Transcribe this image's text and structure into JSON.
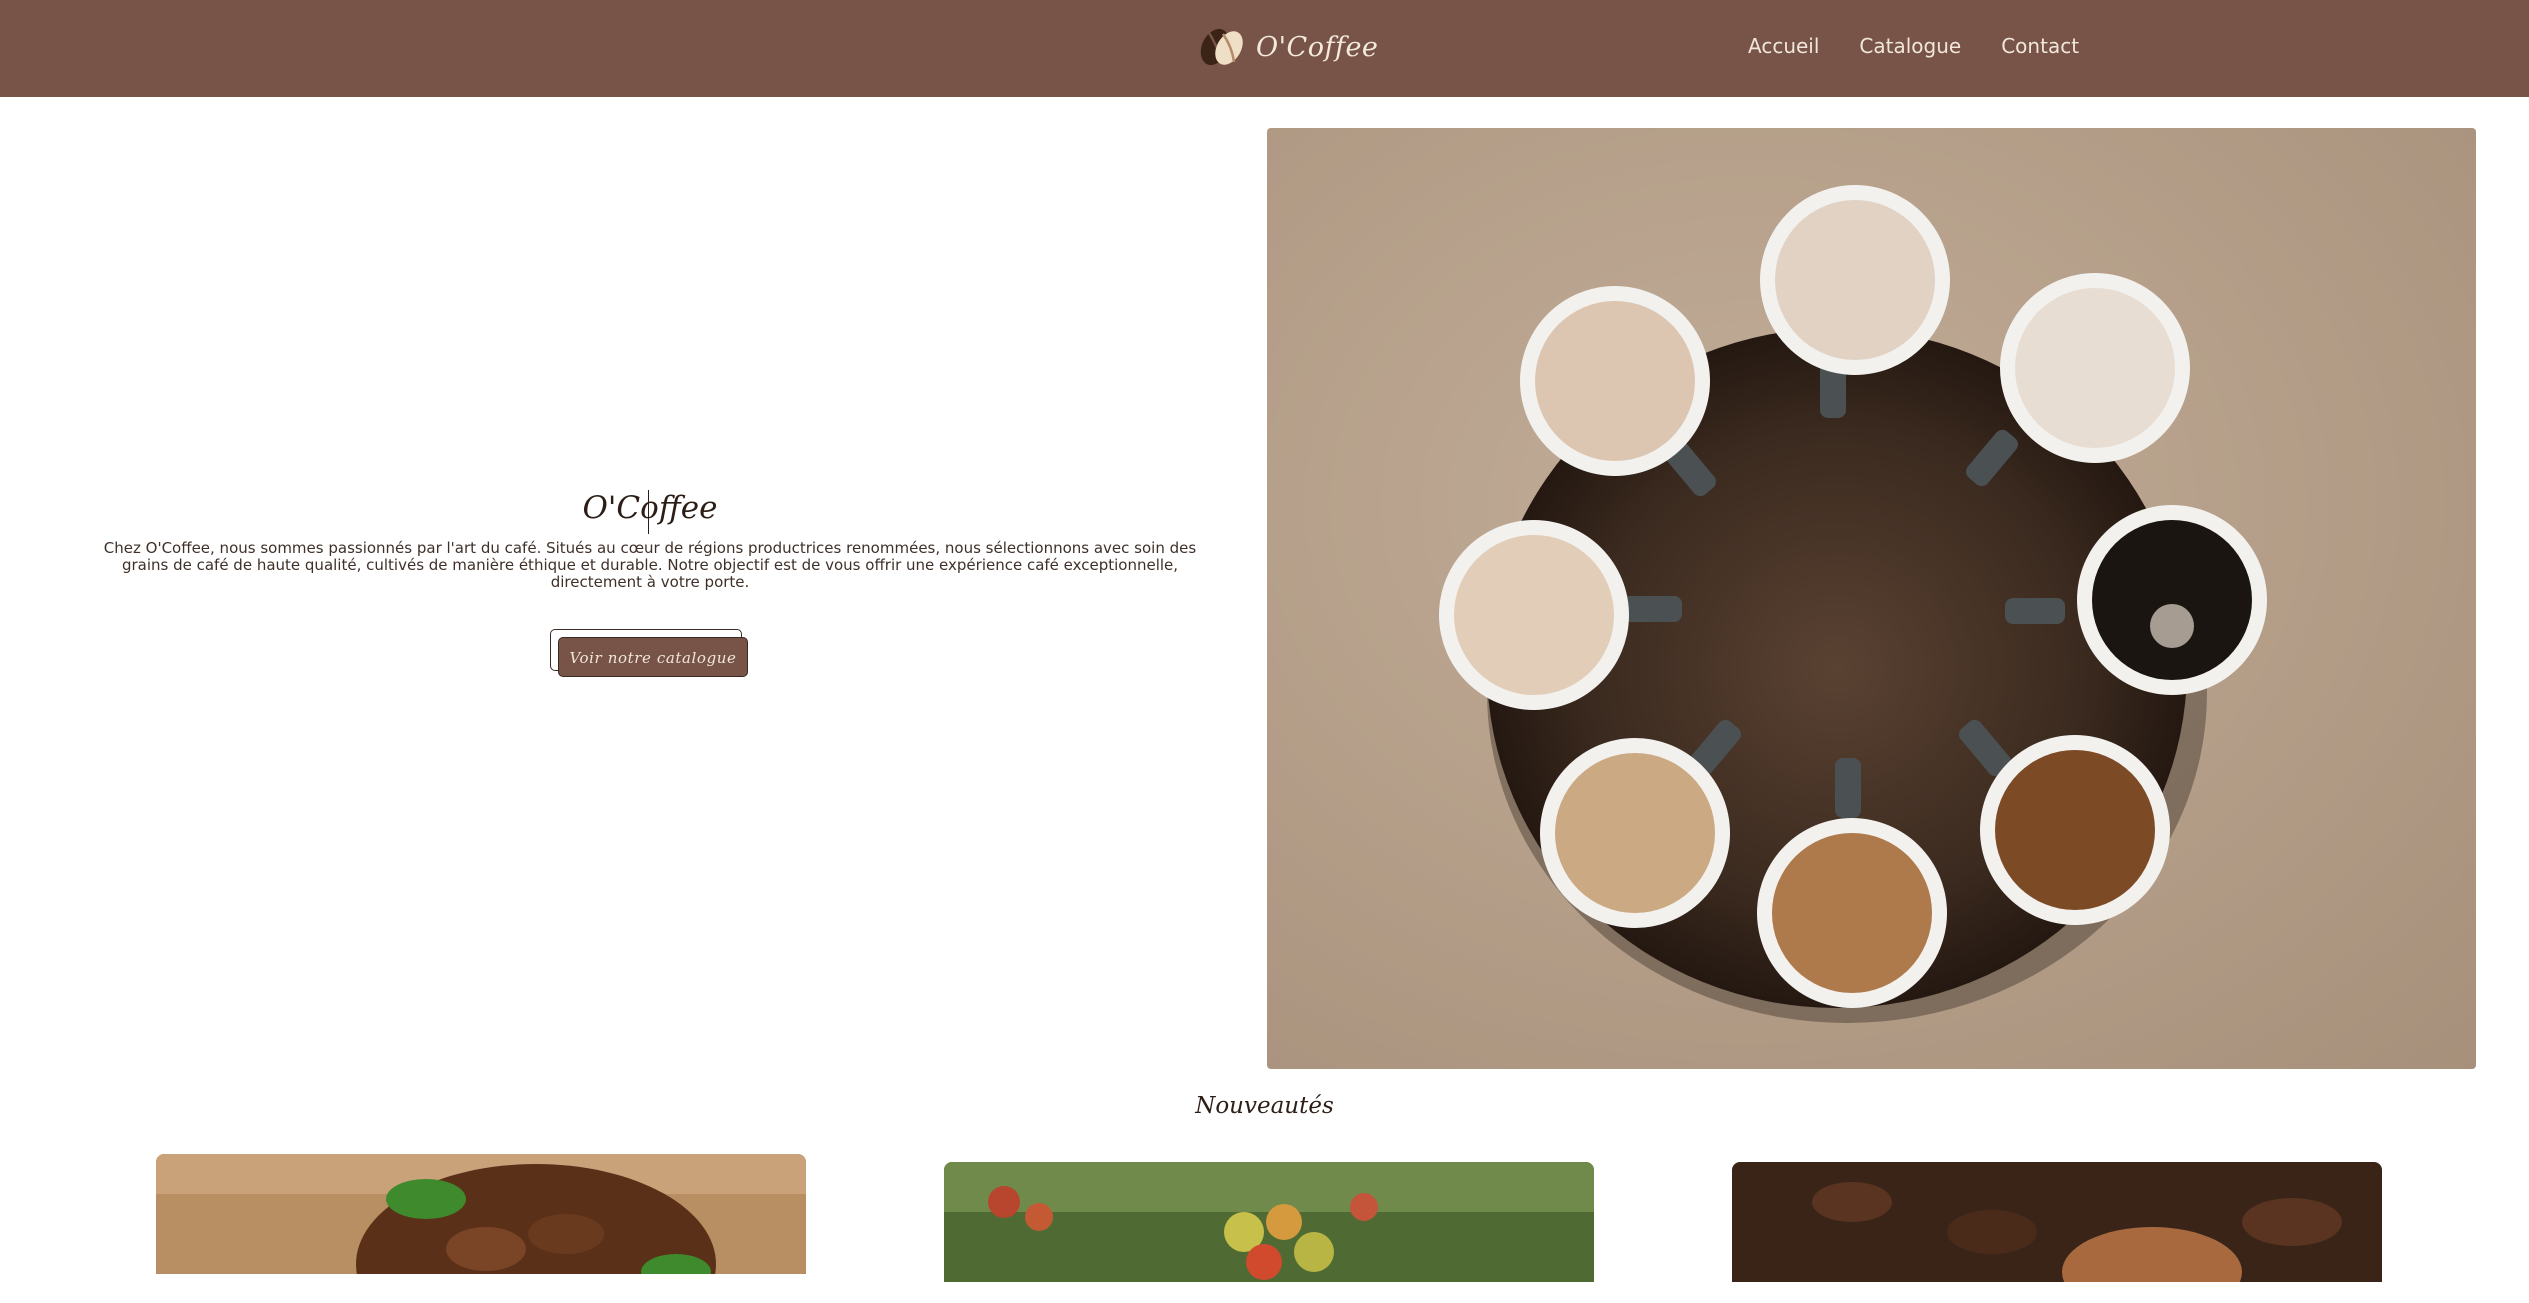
{
  "header": {
    "brand_name": "O'Coffee",
    "nav": [
      "Accueil",
      "Catalogue",
      "Contact"
    ]
  },
  "hero": {
    "title": "O'Coffee",
    "text": "Chez O'Coffee, nous sommes passionnés par l'art du café. Situés au cœur de régions productrices renommées, nous sélectionnons avec soin des grains de café de haute qualité, cultivés de manière éthique et durable. Notre objectif est de vous offrir une expérience café exceptionnelle, directement à votre porte.",
    "cta_label": "Voir notre catalogue"
  },
  "new_section": {
    "title": "Nouveautés"
  },
  "colors": {
    "header_bg": "#785448",
    "accent": "#785448",
    "text_dark": "#2c1e16"
  },
  "icons": [
    "coffee-bean-logo-icon"
  ]
}
